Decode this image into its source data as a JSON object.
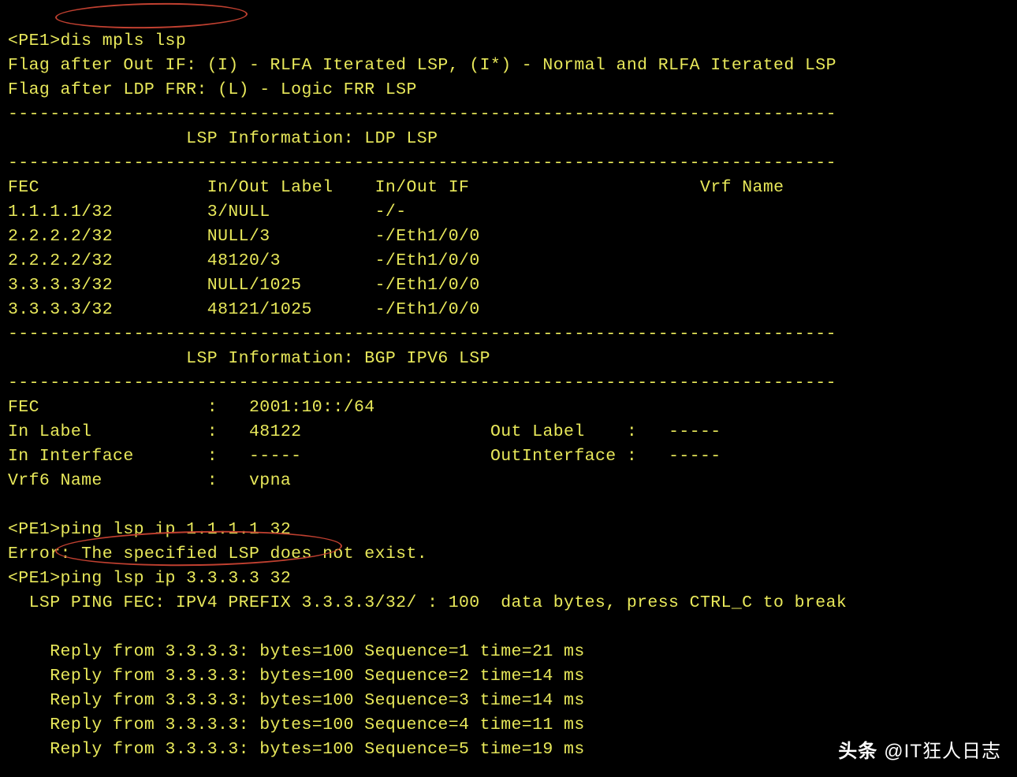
{
  "prompt_host": "<PE1>",
  "cmd1": "dis mpls lsp",
  "flag1": "Flag after Out IF: (I) - RLFA Iterated LSP, (I*) - Normal and RLFA Iterated LSP",
  "flag2": "Flag after LDP FRR: (L) - Logic FRR LSP",
  "dash_full": "-------------------------------------------------------------------------------",
  "section1_title": "                 LSP Information: LDP LSP",
  "table_header": {
    "fec": "FEC",
    "inout_label": "In/Out Label",
    "inout_if": "In/Out IF",
    "vrf": "Vrf Name"
  },
  "lsp_rows": [
    {
      "fec": "1.1.1.1/32",
      "label": "3/NULL",
      "if": "-/-"
    },
    {
      "fec": "2.2.2.2/32",
      "label": "NULL/3",
      "if": "-/Eth1/0/0"
    },
    {
      "fec": "2.2.2.2/32",
      "label": "48120/3",
      "if": "-/Eth1/0/0"
    },
    {
      "fec": "3.3.3.3/32",
      "label": "NULL/1025",
      "if": "-/Eth1/0/0"
    },
    {
      "fec": "3.3.3.3/32",
      "label": "48121/1025",
      "if": "-/Eth1/0/0"
    }
  ],
  "section2_title": "                 LSP Information: BGP IPV6 LSP",
  "bgp": {
    "fec_label": "FEC",
    "fec_val": "2001:10::/64",
    "inlabel_label": "In Label",
    "inlabel_val": "48122",
    "outlabel_label": "Out Label",
    "outlabel_val": "-----",
    "inif_label": "In Interface",
    "inif_val": "-----",
    "outif_label": "OutInterface",
    "outif_val": "-----",
    "vrf6_label": "Vrf6 Name",
    "vrf6_val": "vpna"
  },
  "ping1_cmd": "ping lsp ip 1.1.1.1 32",
  "ping1_err": "Error: The specified LSP does not exist.",
  "ping2_cmd": "ping lsp ip 3.3.3.3 32",
  "ping_header": "  LSP PING FEC: IPV4 PREFIX 3.3.3.3/32/ : 100  data bytes, press CTRL_C to break",
  "replies": [
    "    Reply from 3.3.3.3: bytes=100 Sequence=1 time=21 ms",
    "    Reply from 3.3.3.3: bytes=100 Sequence=2 time=14 ms",
    "    Reply from 3.3.3.3: bytes=100 Sequence=3 time=14 ms",
    "    Reply from 3.3.3.3: bytes=100 Sequence=4 time=11 ms",
    "    Reply from 3.3.3.3: bytes=100 Sequence=5 time=19 ms"
  ],
  "watermark": {
    "brand": "头条",
    "handle": "@IT狂人日志"
  }
}
